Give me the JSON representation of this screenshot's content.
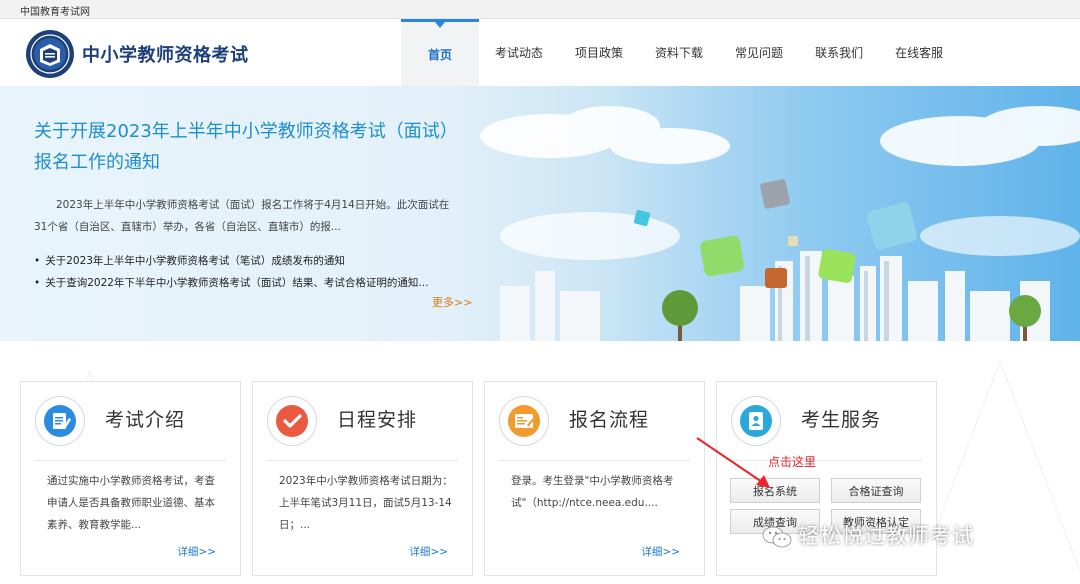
{
  "topbar": {
    "text": "中国教育考试网"
  },
  "header": {
    "site_title": "中小学教师资格考试",
    "nav": [
      {
        "label": "首页",
        "active": true
      },
      {
        "label": "考试动态"
      },
      {
        "label": "项目政策"
      },
      {
        "label": "资料下载"
      },
      {
        "label": "常见问题"
      },
      {
        "label": "联系我们"
      },
      {
        "label": "在线客服"
      }
    ]
  },
  "banner": {
    "title": "关于开展2023年上半年中小学教师资格考试（面试）报名工作的通知",
    "summary": "2023年上半年中小学教师资格考试（面试）报名工作将于4月14日开始。此次面试在31个省（自治区、直辖市）举办，各省（自治区、直辖市）的报...",
    "news": [
      "关于2023年上半年中小学教师资格考试（笔试）成绩发布的通知",
      "关于查询2022年下半年中小学教师资格考试（面试）结果、考试合格证明的通知..."
    ],
    "more": "更多>>"
  },
  "cards": [
    {
      "title": "考试介绍",
      "icon": "exam-intro-icon",
      "body": "通过实施中小学教师资格考试，考查申请人是否具备教师职业道德、基本素养、教育教学能...",
      "more": "详细>>"
    },
    {
      "title": "日程安排",
      "icon": "checkmark-icon",
      "body": "2023年中小学教师资格考试日期为：上半年笔试3月11日，面试5月13-14日；...",
      "more": "详细>>"
    },
    {
      "title": "报名流程",
      "icon": "registration-form-icon",
      "body": "登录。考生登录\"中小学教师资格考试\"（http://ntce.neea.edu....",
      "more": "详细>>"
    },
    {
      "title": "考生服务",
      "icon": "contacts-icon",
      "buttons": [
        "报名系统",
        "合格证查询",
        "成绩查询",
        "教师资格认定"
      ]
    }
  ],
  "annotation": {
    "text": "点击这里"
  },
  "watermark": {
    "text": "轻松悦过教师考试"
  },
  "colors": {
    "brand": "#1d3f7a",
    "accent": "#2a88d8",
    "more_link": "#e07a14",
    "annotation": "#e8262b"
  }
}
